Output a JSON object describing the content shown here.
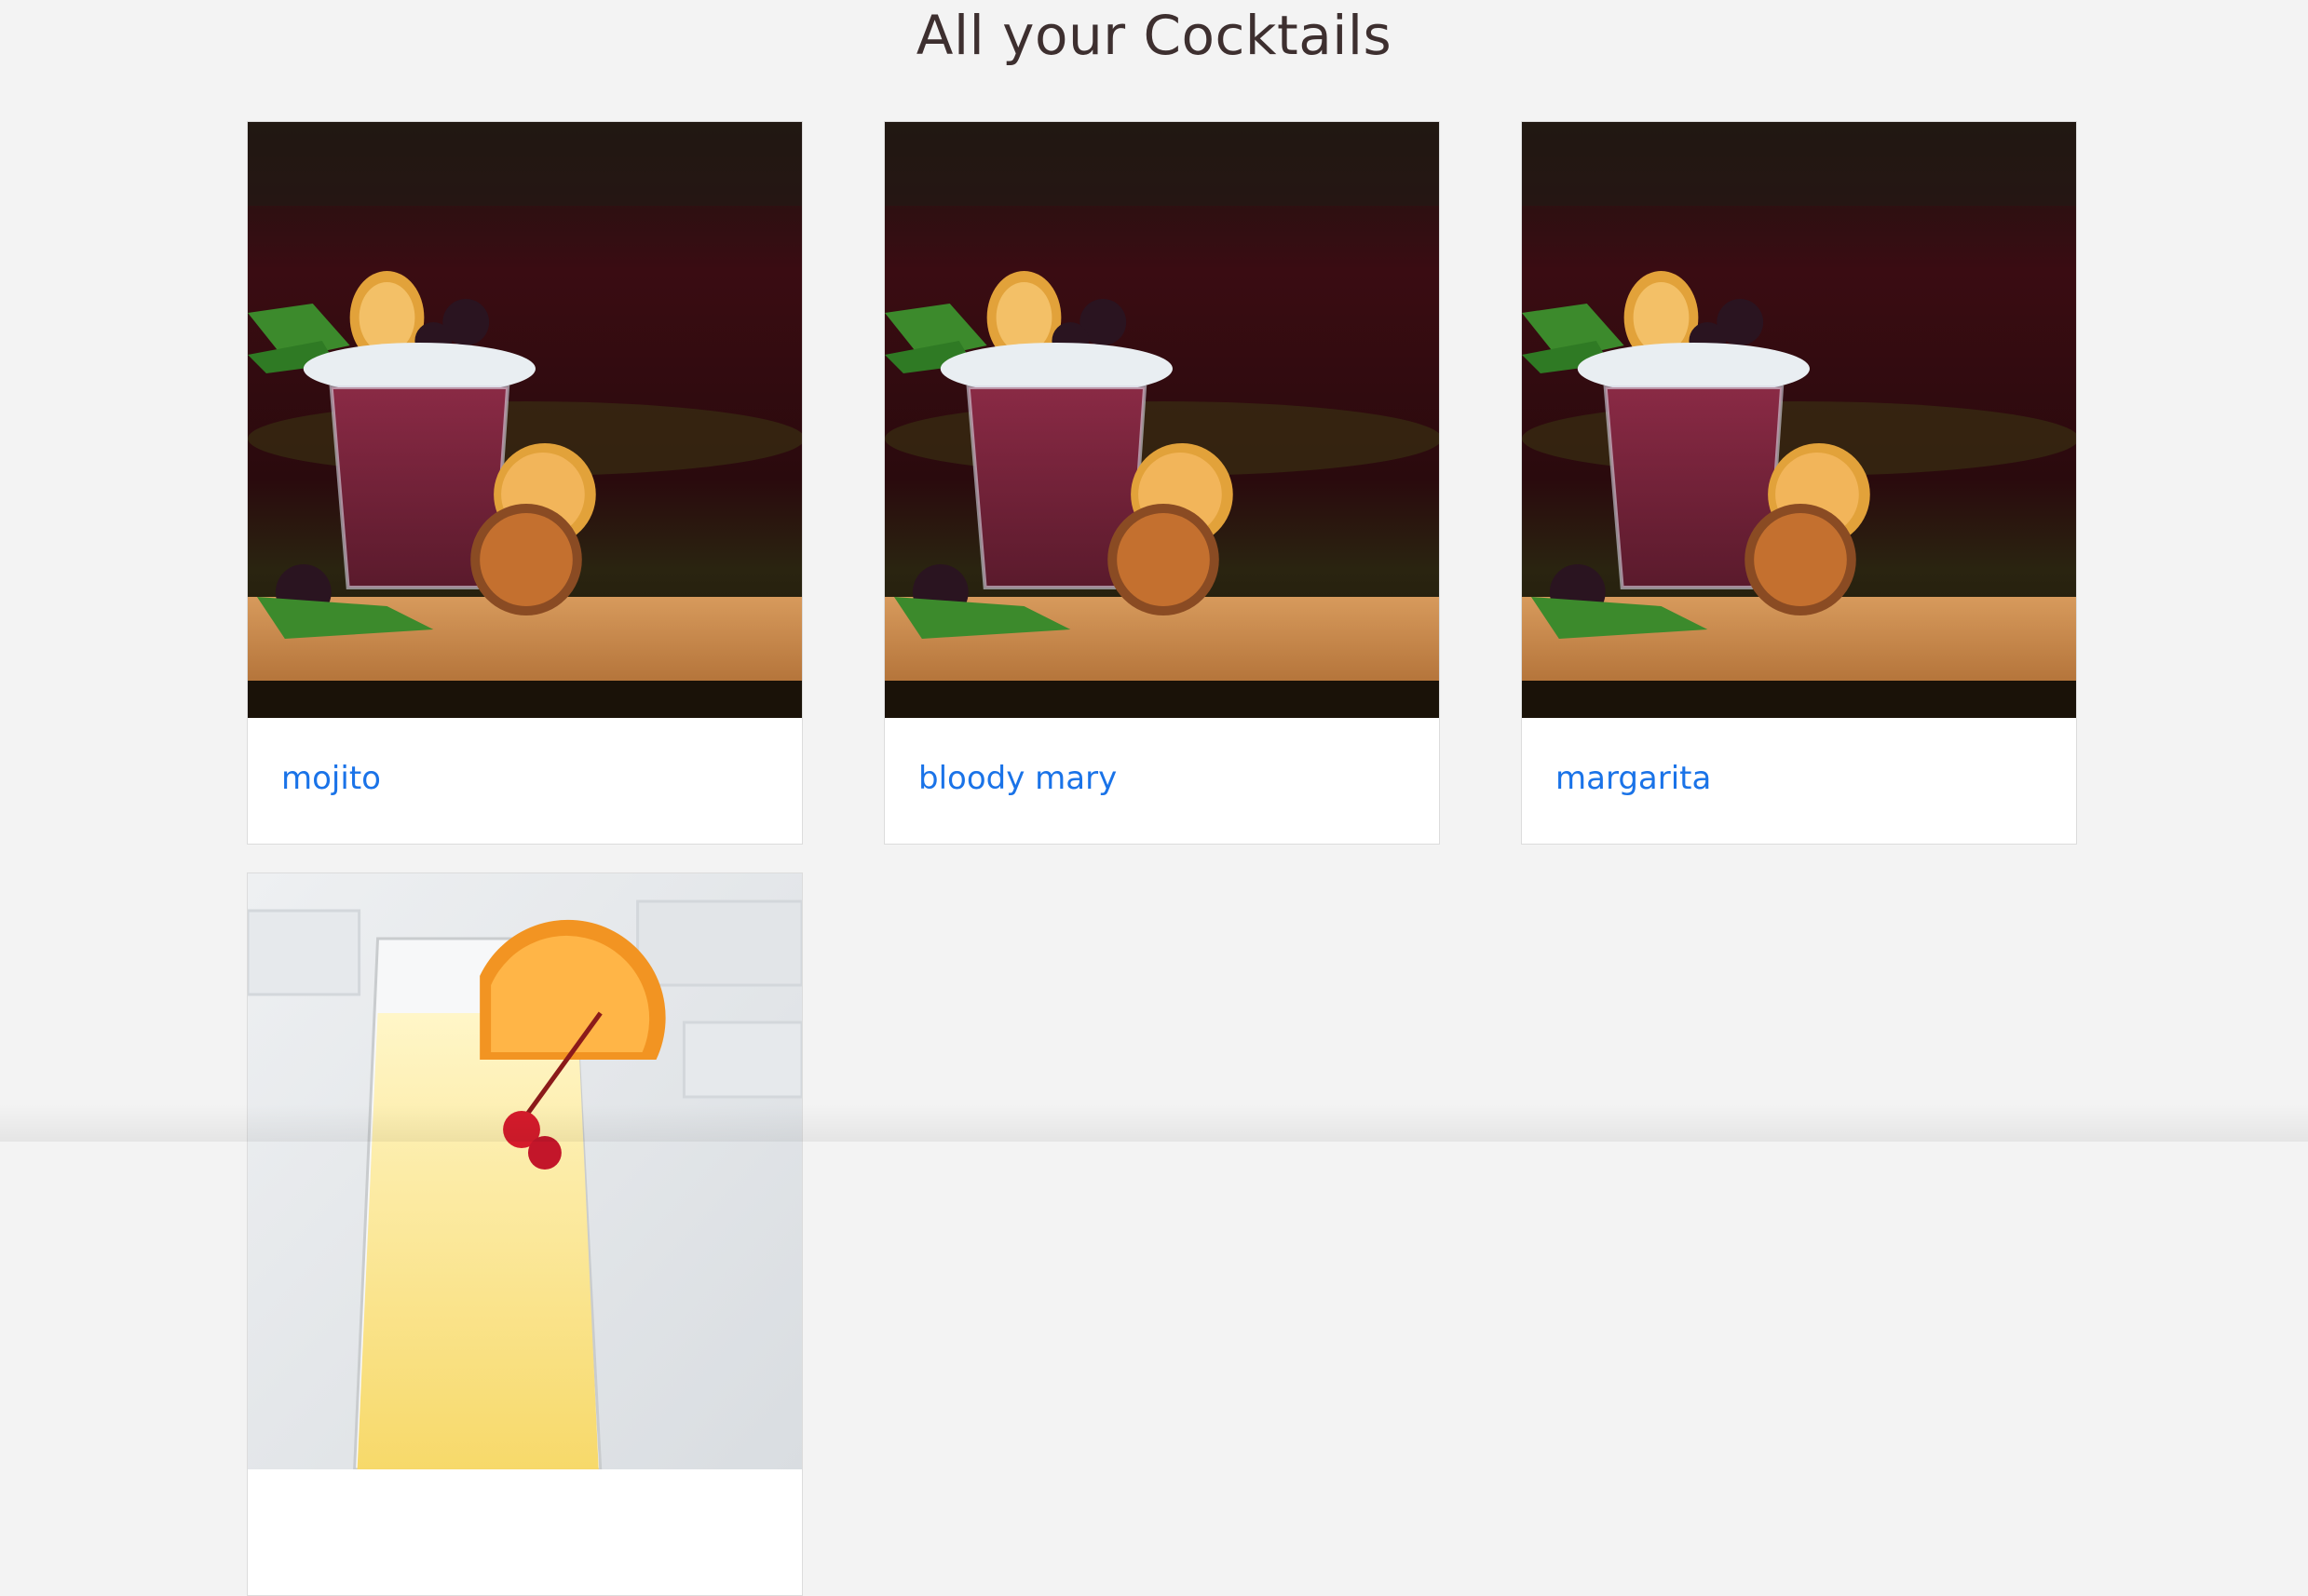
{
  "page": {
    "title": "All your Cocktails"
  },
  "cocktails": [
    {
      "name": "mojito",
      "image": "berry-cocktail-photo"
    },
    {
      "name": "bloody mary",
      "image": "berry-cocktail-photo"
    },
    {
      "name": "margarita",
      "image": "berry-cocktail-photo"
    },
    {
      "name": "",
      "image": "orange-cocktail-photo"
    }
  ],
  "colors": {
    "background": "#f3f3f3",
    "title": "#3d2f2f",
    "link": "#1a73e8"
  }
}
